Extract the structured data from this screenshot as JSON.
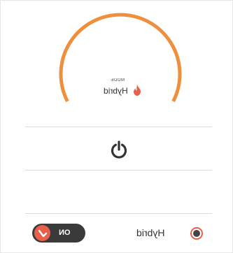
{
  "dial": {
    "caption": "MODE",
    "value": "Hybrid",
    "accent_color": "#ee8f3e"
  },
  "icons": {
    "mode": "flame-icon",
    "power": "power-icon",
    "toggle": "check-icon"
  },
  "toggle": {
    "label": "ON",
    "state": "on",
    "track_color": "#3a3a3a",
    "knob_color": "#e8604c"
  },
  "options": [
    {
      "label": "Hybrid",
      "selected": true,
      "color": "#e8604c"
    }
  ]
}
